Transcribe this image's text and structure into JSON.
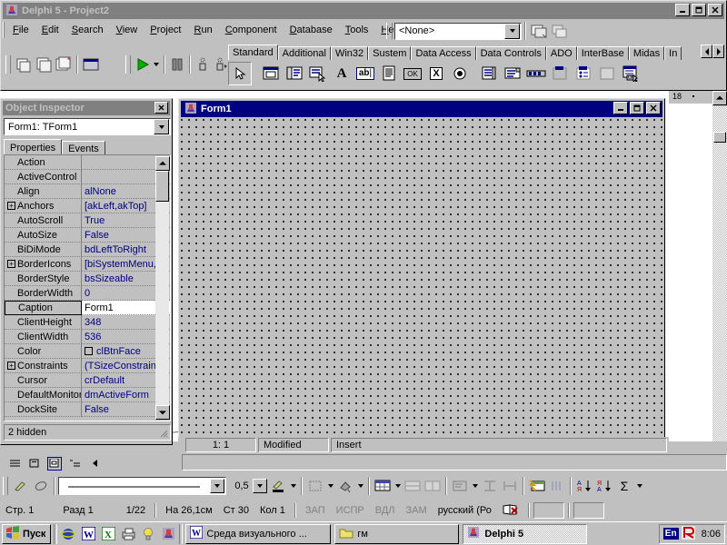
{
  "delphi": {
    "title": "Delphi 5 - Project2",
    "window_buttons": [
      "minimize",
      "maximize",
      "close"
    ],
    "menu": [
      {
        "label": "File",
        "accel": "F"
      },
      {
        "label": "Edit",
        "accel": "E"
      },
      {
        "label": "Search",
        "accel": "S"
      },
      {
        "label": "View",
        "accel": "V"
      },
      {
        "label": "Project",
        "accel": "P"
      },
      {
        "label": "Run",
        "accel": "R"
      },
      {
        "label": "Component",
        "accel": "C"
      },
      {
        "label": "Database",
        "accel": "D"
      },
      {
        "label": "Tools",
        "accel": "T"
      },
      {
        "label": "Help",
        "accel": "H"
      }
    ],
    "project_combo": {
      "value": "<None>"
    },
    "toolbar_icons": [
      "open-project-icon",
      "save-all-icon",
      "add-file-icon",
      "remove-file-icon",
      "toggle-form-unit-icon",
      "run-icon",
      "run-dropdown-icon",
      "pause-icon",
      "trace-into-icon",
      "step-over-icon"
    ]
  },
  "palette": {
    "tabs": [
      {
        "label": "Standard",
        "active": true
      },
      {
        "label": "Additional",
        "active": false
      },
      {
        "label": "Win32",
        "active": false
      },
      {
        "label": "Sustem",
        "active": false
      },
      {
        "label": "Data Access",
        "active": false
      },
      {
        "label": "Data Controls",
        "active": false
      },
      {
        "label": "ADO",
        "active": false
      },
      {
        "label": "InterBase",
        "active": false
      },
      {
        "label": "Midas",
        "active": false
      },
      {
        "label": "In",
        "active": false
      }
    ],
    "scroll_left": "◄",
    "scroll_right": "►",
    "components": [
      {
        "name": "pointer-tool",
        "selected": true
      },
      {
        "name": "frames-component"
      },
      {
        "name": "mainmenu-component"
      },
      {
        "name": "popupmenu-component"
      },
      {
        "name": "label-component",
        "glyph": "A"
      },
      {
        "name": "edit-component",
        "glyph": "ab"
      },
      {
        "name": "memo-component"
      },
      {
        "name": "button-component",
        "glyph": "OK"
      },
      {
        "name": "checkbox-component",
        "glyph": "X"
      },
      {
        "name": "radiobutton-component"
      },
      {
        "name": "listbox-component"
      },
      {
        "name": "combobox-component"
      },
      {
        "name": "scrollbar-component"
      },
      {
        "name": "groupbox-component"
      },
      {
        "name": "radiogroup-component"
      },
      {
        "name": "panel-component"
      },
      {
        "name": "actionlist-component"
      }
    ]
  },
  "object_inspector": {
    "title": "Object Inspector",
    "close_label": "×",
    "object_combo": {
      "value": "Form1: TForm1"
    },
    "tabs": [
      {
        "label": "Properties",
        "active": true
      },
      {
        "label": "Events",
        "active": false
      }
    ],
    "status": "2 hidden",
    "properties": [
      {
        "name": "Action",
        "value": "",
        "expandable": false,
        "selected": false
      },
      {
        "name": "ActiveControl",
        "value": "",
        "expandable": false,
        "selected": false
      },
      {
        "name": "Align",
        "value": "alNone",
        "expandable": false,
        "selected": false
      },
      {
        "name": "Anchors",
        "value": "[akLeft,akTop]",
        "expandable": true,
        "selected": false
      },
      {
        "name": "AutoScroll",
        "value": "True",
        "expandable": false,
        "selected": false
      },
      {
        "name": "AutoSize",
        "value": "False",
        "expandable": false,
        "selected": false
      },
      {
        "name": "BiDiMode",
        "value": "bdLeftToRight",
        "expandable": false,
        "selected": false
      },
      {
        "name": "BorderIcons",
        "value": "[biSystemMenu,",
        "expandable": true,
        "selected": false
      },
      {
        "name": "BorderStyle",
        "value": "bsSizeable",
        "expandable": false,
        "selected": false
      },
      {
        "name": "BorderWidth",
        "value": "0",
        "expandable": false,
        "selected": false
      },
      {
        "name": "Caption",
        "value": "Form1",
        "expandable": false,
        "selected": true
      },
      {
        "name": "ClientHeight",
        "value": "348",
        "expandable": false,
        "selected": false
      },
      {
        "name": "ClientWidth",
        "value": "536",
        "expandable": false,
        "selected": false
      },
      {
        "name": "Color",
        "value": "clBtnFace",
        "expandable": false,
        "selected": false,
        "swatch": "#c0c0c0"
      },
      {
        "name": "Constraints",
        "value": "(TSizeConstrain",
        "expandable": true,
        "selected": false
      },
      {
        "name": "Cursor",
        "value": "crDefault",
        "expandable": false,
        "selected": false
      },
      {
        "name": "DefaultMonitor",
        "value": "dmActiveForm",
        "expandable": false,
        "selected": false
      },
      {
        "name": "DockSite",
        "value": "False",
        "expandable": false,
        "selected": false
      }
    ]
  },
  "form_designer": {
    "title": "Form1",
    "buttons": [
      "minimize",
      "maximize",
      "close"
    ]
  },
  "editor_status": {
    "cursor": "1:  1",
    "modified": "Modified",
    "insert_mode": "Insert"
  },
  "word": {
    "ruler_mark": "18",
    "view_buttons": [
      "normal-view",
      "web-layout-view",
      "print-layout-view",
      "outline-view",
      "collapse-view"
    ],
    "drawing_toolbar": {
      "pen_icons": [
        "draw-pen-icon",
        "eraser-icon"
      ],
      "line_style_combo": {
        "value": ""
      },
      "line_weight": "0,5",
      "pen_color_icon": "pen-color-icon",
      "border_icons": [
        "border-style-icon",
        "shading-color-icon",
        "insert-table-icon",
        "merge-cells-icon",
        "split-cells-icon",
        "align-icon",
        "distribute-rows-icon",
        "distribute-columns-icon",
        "table-autoformat-icon",
        "change-direction-icon"
      ],
      "sort_icons": [
        "sort-ascending-icon",
        "sort-descending-icon"
      ],
      "autosum": "Σ"
    },
    "status_bar": {
      "page": "Стр. 1",
      "section": "Разд 1",
      "pages": "1/22",
      "position": "На 26,1см",
      "line": "Ст 30",
      "column": "Кол 1",
      "rec": "ЗАП",
      "trk": "ИСПР",
      "ext": "ВДЛ",
      "ovr": "ЗАМ",
      "language": "русский (Ро",
      "spell_icon": "spellcheck-icon"
    }
  },
  "taskbar": {
    "start_label": "Пуск",
    "quick_launch": [
      {
        "name": "internet-explorer-icon"
      },
      {
        "name": "word-icon"
      },
      {
        "name": "excel-icon"
      },
      {
        "name": "printer-icon"
      },
      {
        "name": "tip-icon"
      },
      {
        "name": "delphi-icon"
      }
    ],
    "tasks": [
      {
        "label": "Среда визуального ...",
        "icon": "word-icon",
        "active": false
      },
      {
        "label": "гм",
        "icon": "folder-icon",
        "active": false
      },
      {
        "label": "Delphi 5",
        "icon": "delphi-icon",
        "active": true
      }
    ],
    "tray": {
      "language": "En",
      "icon": "antivirus-icon",
      "time": "8:06"
    }
  }
}
